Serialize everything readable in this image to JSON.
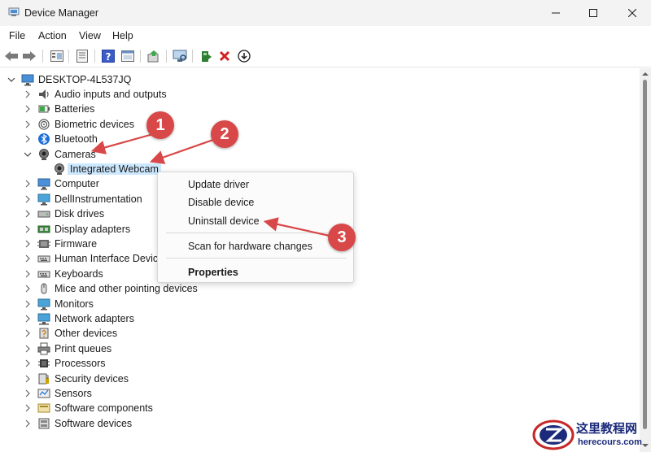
{
  "window": {
    "title": "Device Manager",
    "minimize_icon": "minimize-icon",
    "maximize_icon": "maximize-icon",
    "close_icon": "close-icon"
  },
  "menu": [
    "File",
    "Action",
    "View",
    "Help"
  ],
  "toolbar": {
    "buttons": [
      "back-icon",
      "forward-icon",
      "properties-view-icon",
      "device-list-icon",
      "help-icon",
      "show-hidden-icon",
      "update-driver-icon",
      "scan-hardware-icon",
      "add-driver-icon",
      "uninstall-icon",
      "disable-icon"
    ]
  },
  "tree": {
    "root": "DESKTOP-4L537JQ",
    "items": [
      {
        "label": "Audio inputs and outputs",
        "icon": "speaker-icon",
        "expanded": false
      },
      {
        "label": "Batteries",
        "icon": "battery-icon",
        "expanded": false
      },
      {
        "label": "Biometric devices",
        "icon": "fingerprint-icon",
        "expanded": false
      },
      {
        "label": "Bluetooth",
        "icon": "bluetooth-icon",
        "expanded": false
      },
      {
        "label": "Cameras",
        "icon": "camera-icon",
        "expanded": true
      },
      {
        "label": "Integrated Webcam",
        "icon": "webcam-icon",
        "child": true,
        "selected": true
      },
      {
        "label": "Computer",
        "icon": "computer-icon",
        "expanded": false
      },
      {
        "label": "DellInstrumentation",
        "icon": "monitor-icon",
        "expanded": false
      },
      {
        "label": "Disk drives",
        "icon": "disk-icon",
        "expanded": false
      },
      {
        "label": "Display adapters",
        "icon": "display-adapter-icon",
        "expanded": false
      },
      {
        "label": "Firmware",
        "icon": "firmware-icon",
        "expanded": false
      },
      {
        "label": "Human Interface Device",
        "icon": "hid-icon",
        "expanded": false
      },
      {
        "label": "Keyboards",
        "icon": "keyboard-icon",
        "expanded": false
      },
      {
        "label": "Mice and other pointing devices",
        "icon": "mouse-icon",
        "expanded": false
      },
      {
        "label": "Monitors",
        "icon": "monitor-icon",
        "expanded": false
      },
      {
        "label": "Network adapters",
        "icon": "network-icon",
        "expanded": false
      },
      {
        "label": "Other devices",
        "icon": "other-devices-icon",
        "expanded": false
      },
      {
        "label": "Print queues",
        "icon": "printer-icon",
        "expanded": false
      },
      {
        "label": "Processors",
        "icon": "processor-icon",
        "expanded": false
      },
      {
        "label": "Security devices",
        "icon": "security-icon",
        "expanded": false
      },
      {
        "label": "Sensors",
        "icon": "sensor-icon",
        "expanded": false
      },
      {
        "label": "Software components",
        "icon": "software-component-icon",
        "expanded": false
      },
      {
        "label": "Software devices",
        "icon": "software-device-icon",
        "expanded": false
      }
    ]
  },
  "context_menu": {
    "items": [
      "Update driver",
      "Disable device",
      "Uninstall device"
    ],
    "scan": "Scan for hardware changes",
    "properties": "Properties"
  },
  "annotations": [
    "1",
    "2",
    "3"
  ],
  "watermark": {
    "title": "这里教程网",
    "url": "herecours.com",
    "logo_icon": "z-logo-icon"
  },
  "colors": {
    "selection": "#cce8ff",
    "annotation": "#d94848",
    "titlebar": "#f3f3f3",
    "watermark": "#1b2a7a"
  }
}
